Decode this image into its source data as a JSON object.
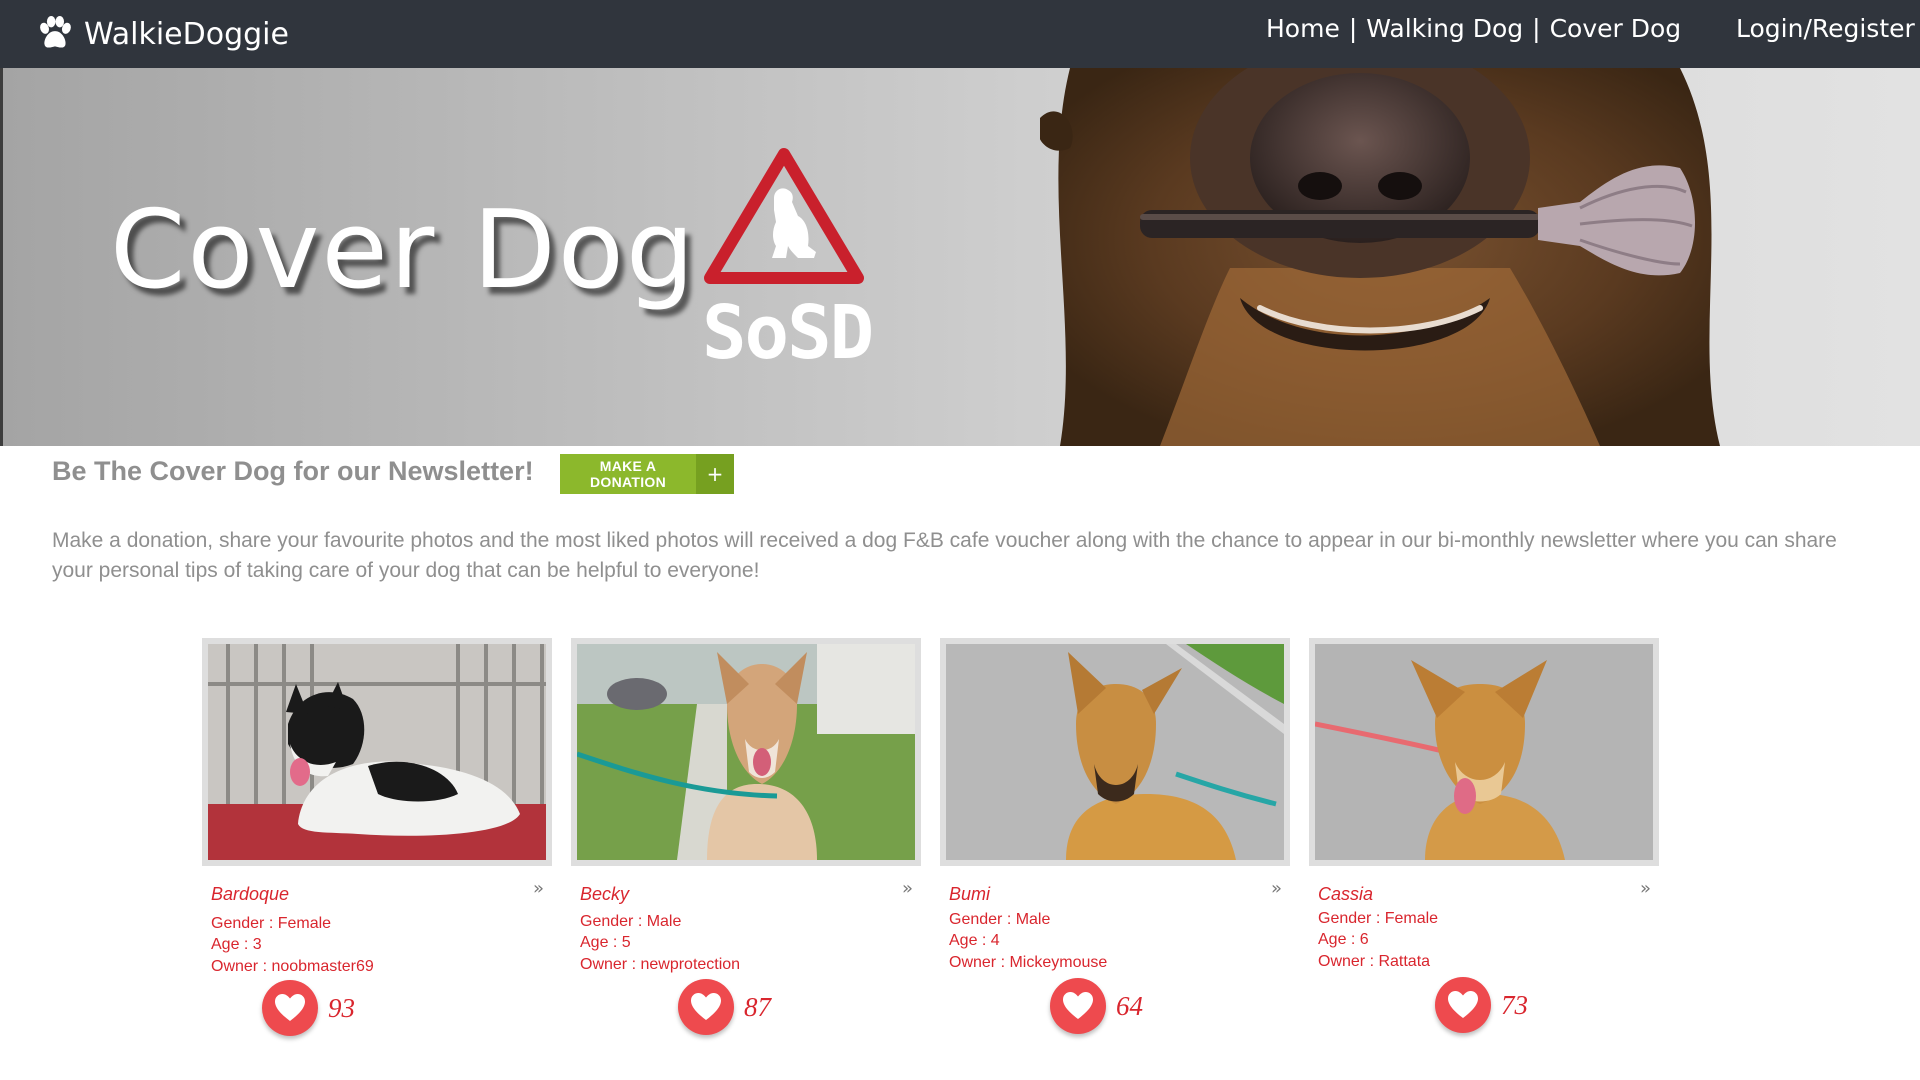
{
  "header": {
    "brand": "WalkieDoggie",
    "nav": [
      "Home",
      "Walking Dog",
      "Cover Dog"
    ],
    "nav_separator": "|",
    "login": "Login/Register"
  },
  "hero": {
    "title": "Cover Dog",
    "logo_text": "SoSD"
  },
  "intro": {
    "headline": "Be The Cover Dog for our Newsletter!",
    "donate_label": "MAKE A DONATION",
    "donate_plus": "+",
    "description": "Make a donation, share your favourite photos and the most liked photos will received a dog F&B cafe voucher along with the chance to appear in our bi-monthly newsletter where you can share your personal tips of taking care of your dog that can be helpful to everyone!"
  },
  "more_glyph": "»",
  "dogs": [
    {
      "name": "Bardoque",
      "gender": "Gender : Female",
      "age": "Age : 3",
      "owner": "Owner : noobmaster69",
      "likes": "93"
    },
    {
      "name": "Becky",
      "gender": "Gender : Male",
      "age": "Age : 5",
      "owner": "Owner : newprotection",
      "likes": "87"
    },
    {
      "name": "Bumi",
      "gender": "Gender : Male",
      "age": "Age : 4",
      "owner": "Owner : Mickeymouse",
      "likes": "64"
    },
    {
      "name": "Cassia",
      "gender": "Gender : Female",
      "age": "Age : 6",
      "owner": "Owner : Rattata",
      "likes": "73"
    }
  ],
  "colors": {
    "topbar": "#30353d",
    "accent_red": "#d9262e",
    "heart": "#ee4a4e",
    "donate_green": "#8cb82c",
    "muted_text": "#8f8f8f"
  }
}
